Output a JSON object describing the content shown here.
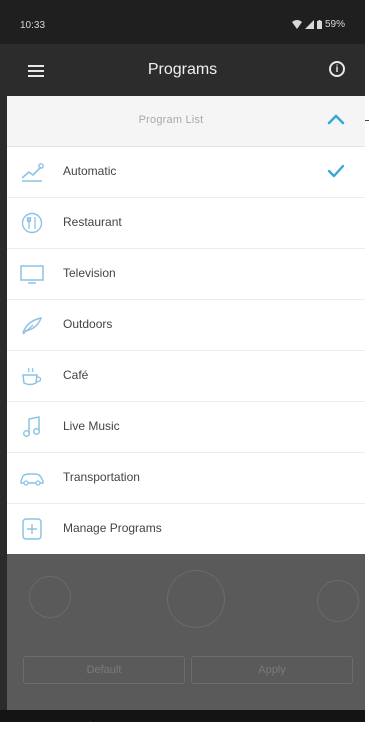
{
  "status_bar": {
    "time": "10:33",
    "battery": "59%"
  },
  "app_bar": {
    "title": "Programs"
  },
  "program_list": {
    "header": "Program List",
    "items": [
      {
        "label": "Automatic",
        "icon": "automatic-icon",
        "selected": true
      },
      {
        "label": "Restaurant",
        "icon": "restaurant-icon",
        "selected": false
      },
      {
        "label": "Television",
        "icon": "television-icon",
        "selected": false
      },
      {
        "label": "Outdoors",
        "icon": "outdoors-icon",
        "selected": false
      },
      {
        "label": "Café",
        "icon": "cafe-icon",
        "selected": false
      },
      {
        "label": "Live Music",
        "icon": "music-note-icon",
        "selected": false
      },
      {
        "label": "Transportation",
        "icon": "car-icon",
        "selected": false
      },
      {
        "label": "Manage Programs",
        "icon": "manage-programs-icon",
        "selected": false
      }
    ]
  },
  "background": {
    "left_button": "Default",
    "right_button": "Apply"
  },
  "colors": {
    "accent": "#3aa6d8",
    "app_bar": "#2c2c2c",
    "icon_blue": "#8cc3e3"
  }
}
